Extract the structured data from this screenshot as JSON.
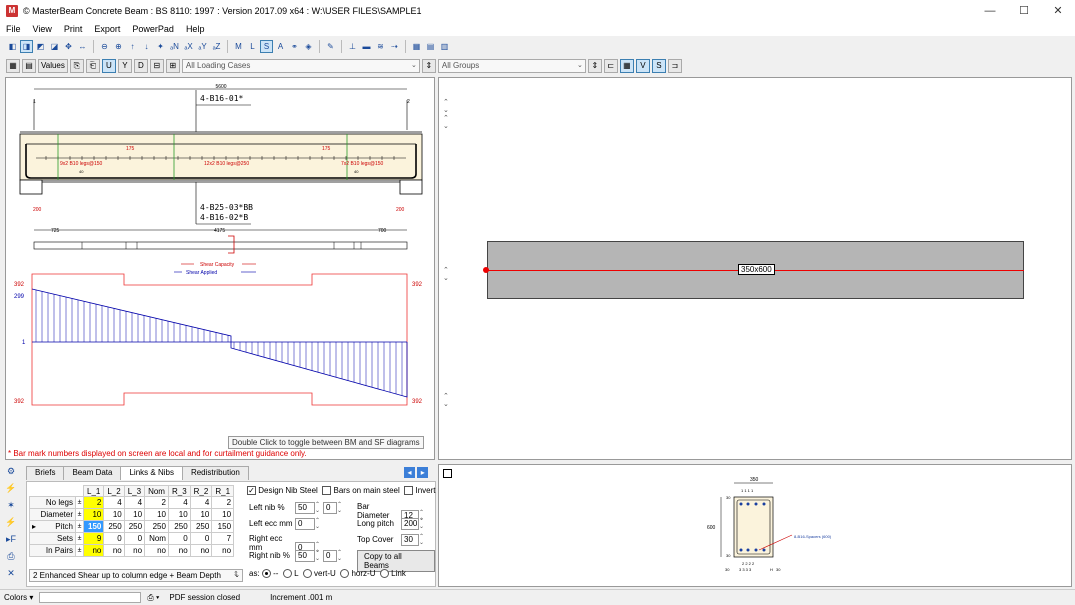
{
  "window": {
    "title": "© MasterBeam Concrete Beam : BS 8110: 1997 : Version 2017.09 x64 : W:\\USER FILES\\SAMPLE1",
    "minimize": "—",
    "maximize": "☐",
    "close": "✕"
  },
  "menu": [
    "File",
    "View",
    "Print",
    "Export",
    "PowerPad",
    "Help"
  ],
  "toolbar2": {
    "values_label": "Values",
    "u": "U",
    "y": "Y",
    "d": "D",
    "loading_cases": "All Loading Cases",
    "groups": "All Groups",
    "v": "V",
    "s": "S"
  },
  "beam_diagram": {
    "total_span": "5600",
    "support_left": "1",
    "support_right": "2",
    "top_bar_mark": "4-B16-01*",
    "bot_bar_mark_1": "4-B25-03*BB",
    "bot_bar_mark_2": "4-B16-02*B",
    "link_left": "9x2 B10 legs@150",
    "link_mid": "12x2 B10 legs@250",
    "link_right": "7x2 B10 legs@150",
    "dim_175a": "175",
    "dim_175b": "175",
    "dim_200a": "200",
    "dim_200b": "200",
    "dim_725": "725",
    "dim_4175": "4175",
    "dim_700": "700",
    "dim_40a": "40",
    "dim_40b": "40",
    "legend_capacity": "Shear Capacity",
    "legend_applied": "Shear Applied",
    "sf_392_tl": "392",
    "sf_299": "299",
    "sf_1": "1",
    "sf_392_bl": "392",
    "sf_392_tr": "392",
    "sf_392_br": "392",
    "hint": "Double Click to toggle between BM and SF diagrams",
    "note": "* Bar mark numbers displayed on screen are local and for curtailment guidance only."
  },
  "section_view": {
    "label": "350x600"
  },
  "tabs": [
    "Briefs",
    "Beam Data",
    "Links & Nibs",
    "Redistribution"
  ],
  "links_table": {
    "headers": [
      "L_1",
      "L_2",
      "L_3",
      "Nom",
      "R_3",
      "R_2",
      "R_1"
    ],
    "rows": [
      {
        "label": "No legs",
        "values": [
          "2",
          "4",
          "4",
          "2",
          "4",
          "4",
          "2"
        ]
      },
      {
        "label": "Diameter",
        "values": [
          "10",
          "10",
          "10",
          "10",
          "10",
          "10",
          "10"
        ]
      },
      {
        "label": "Pitch",
        "values": [
          "150",
          "250",
          "250",
          "250",
          "250",
          "250",
          "150"
        ]
      },
      {
        "label": "Sets",
        "values": [
          "9",
          "0",
          "0",
          "Nom",
          "0",
          "0",
          "7"
        ]
      },
      {
        "label": "In Pairs",
        "values": [
          "no",
          "no",
          "no",
          "no",
          "no",
          "no",
          "no"
        ]
      }
    ],
    "shear_option": "2 Enhanced Shear up to column edge + Beam Depth"
  },
  "nib_options": {
    "design_nib_steel": "Design Nib Steel",
    "bars_on_main": "Bars on main steel",
    "invert": "Invert",
    "left_nib": "Left nib %",
    "left_nib_v1": "50",
    "left_nib_v2": "0",
    "left_ecc": "Left ecc mm",
    "left_ecc_v": "0",
    "right_ecc": "Right ecc mm",
    "right_ecc_v": "0",
    "right_nib": "Right nib %",
    "right_nib_v1": "50",
    "right_nib_v2": "0",
    "bar_diameter": "Bar Diameter",
    "bar_diameter_v": "12",
    "long_pitch": "Long pitch",
    "long_pitch_v": "200",
    "top_cover": "Top Cover",
    "top_cover_v": "30",
    "copy_btn": "Copy to all Beams",
    "as_label": "as:",
    "opt_dash": "--",
    "opt_l": "L",
    "opt_vert": "vert-U",
    "opt_horz": "horz-U",
    "opt_link": "Link"
  },
  "cross_section": {
    "width": "350",
    "height": "600",
    "spacer_label": "8-B16-Spacers (600)",
    "cover_top": "30",
    "cover_bot": "30",
    "left_30": "30",
    "right_30": "30",
    "bottom_labels": "2  2  2  2",
    "bottom_labels2": "3  3  3  3",
    "top_labels": "1  1  1  1",
    "h_label": "H"
  },
  "status": {
    "colors": "Colors",
    "pdf": "PDF session closed",
    "increment": "Increment .001 m"
  }
}
